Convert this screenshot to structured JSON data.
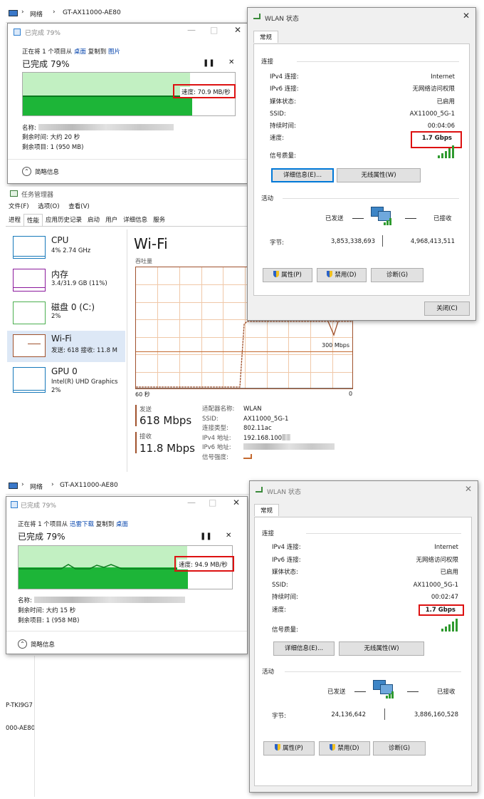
{
  "top": {
    "breadcrumb": {
      "a": "网络",
      "b": "GT-AX11000-AE80"
    },
    "copy": {
      "title": "已完成 79%",
      "line": "正在将 1 个项目从 桌面 复制到 图片",
      "line_prefix": "正在将 1 个项目从 ",
      "src": "桌面",
      "mid": " 复制到 ",
      "dst": "图片",
      "percent": "已完成 79%",
      "progress": 0.79,
      "speed": "速度: 70.9 MB/秒",
      "name_label": "名称:",
      "remaining": "剩余时间: 大约 20 秒",
      "items": "剩余项目: 1 (950 MB)",
      "brief": "简略信息"
    },
    "wlan": {
      "title": "WLAN 状态",
      "tab": "常规",
      "section_conn": "连接",
      "rows": [
        {
          "k": "IPv4 连接:",
          "v": "Internet"
        },
        {
          "k": "IPv6 连接:",
          "v": "无网络访问权限"
        },
        {
          "k": "媒体状态:",
          "v": "已启用"
        },
        {
          "k": "SSID:",
          "v": "AX11000_5G-1"
        },
        {
          "k": "持续时间:",
          "v": "00:04:06"
        },
        {
          "k": "速度:",
          "v": "1.7 Gbps"
        }
      ],
      "signal_label": "信号质量:",
      "details_btn": "详细信息(E)...",
      "wireless_btn": "无线属性(W)",
      "section_activity": "活动",
      "sent": "已发送",
      "received": "已接收",
      "bytes_label": "字节:",
      "bytes_sent": "3,853,338,693",
      "bytes_recv": "4,968,413,511",
      "props_btn": "属性(P)",
      "disable_btn": "禁用(D)",
      "diag_btn": "诊断(G)",
      "close_btn": "关闭(C)"
    },
    "taskmgr": {
      "title": "任务管理器",
      "menu": [
        "文件(F)",
        "选项(O)",
        "查看(V)"
      ],
      "tabs": [
        "进程",
        "性能",
        "应用历史记录",
        "启动",
        "用户",
        "详细信息",
        "服务"
      ],
      "items": [
        {
          "name": "CPU",
          "sub": "4% 2.74 GHz",
          "sub2": ""
        },
        {
          "name": "内存",
          "sub": "3.4/31.9 GB (11%)",
          "sub2": ""
        },
        {
          "name": "磁盘 0 (C:)",
          "sub": "2%",
          "sub2": ""
        },
        {
          "name": "Wi-Fi",
          "sub": "发送: 618 接收: 11.8 M",
          "sub2": ""
        },
        {
          "name": "GPU 0",
          "sub": "Intel(R) UHD Graphics",
          "sub2": "2%"
        }
      ],
      "wifi_title": "Wi-Fi",
      "throughput": "吞吐量",
      "axis_left": "60 秒",
      "axis_right": "0",
      "mark": "300 Mbps",
      "send_label": "发送",
      "send_value": "618 Mbps",
      "recv_label": "接收",
      "recv_value": "11.8 Mbps",
      "info": [
        {
          "k": "适配器名称:",
          "v": "WLAN"
        },
        {
          "k": "SSID:",
          "v": "AX11000_5G-1"
        },
        {
          "k": "连接类型:",
          "v": "802.11ac"
        },
        {
          "k": "IPv4 地址:",
          "v": "192.168.100"
        },
        {
          "k": "IPv6 地址:",
          "v": ""
        },
        {
          "k": "信号强度:",
          "v": ""
        }
      ]
    }
  },
  "bottom": {
    "breadcrumb": {
      "a": "网络",
      "b": "GT-AX11000-AE80"
    },
    "copy": {
      "title": "已完成 79%",
      "line_prefix": "正在将 1 个项目从 ",
      "src": "迅雷下载",
      "mid": " 复制到 ",
      "dst": "桌面",
      "percent": "已完成 79%",
      "progress": 0.79,
      "speed": "速度: 94.9 MB/秒",
      "name_label": "名称:",
      "remaining": "剩余时间: 大约 15 秒",
      "items": "剩余项目: 1 (958 MB)",
      "brief": "简略信息"
    },
    "side_text": [
      "P-TKI9G7",
      "000-AE80"
    ],
    "wlan": {
      "title": "WLAN 状态",
      "tab": "常规",
      "section_conn": "连接",
      "rows": [
        {
          "k": "IPv4 连接:",
          "v": "Internet"
        },
        {
          "k": "IPv6 连接:",
          "v": "无网络访问权限"
        },
        {
          "k": "媒体状态:",
          "v": "已启用"
        },
        {
          "k": "SSID:",
          "v": "AX11000_5G-1"
        },
        {
          "k": "持续时间:",
          "v": "00:02:47"
        },
        {
          "k": "速度:",
          "v": "1.7 Gbps"
        }
      ],
      "signal_label": "信号质量:",
      "details_btn": "详细信息(E)...",
      "wireless_btn": "无线属性(W)",
      "section_activity": "活动",
      "sent": "已发送",
      "received": "已接收",
      "bytes_label": "字节:",
      "bytes_sent": "24,136,642",
      "bytes_recv": "3,886,160,528",
      "props_btn": "属性(P)",
      "disable_btn": "禁用(D)",
      "diag_btn": "诊断(G)"
    }
  },
  "colors": {
    "accent": "#0078d7",
    "highlight": "#d11111",
    "progress": "#06b025",
    "wifi_graph": "#a0522d"
  }
}
